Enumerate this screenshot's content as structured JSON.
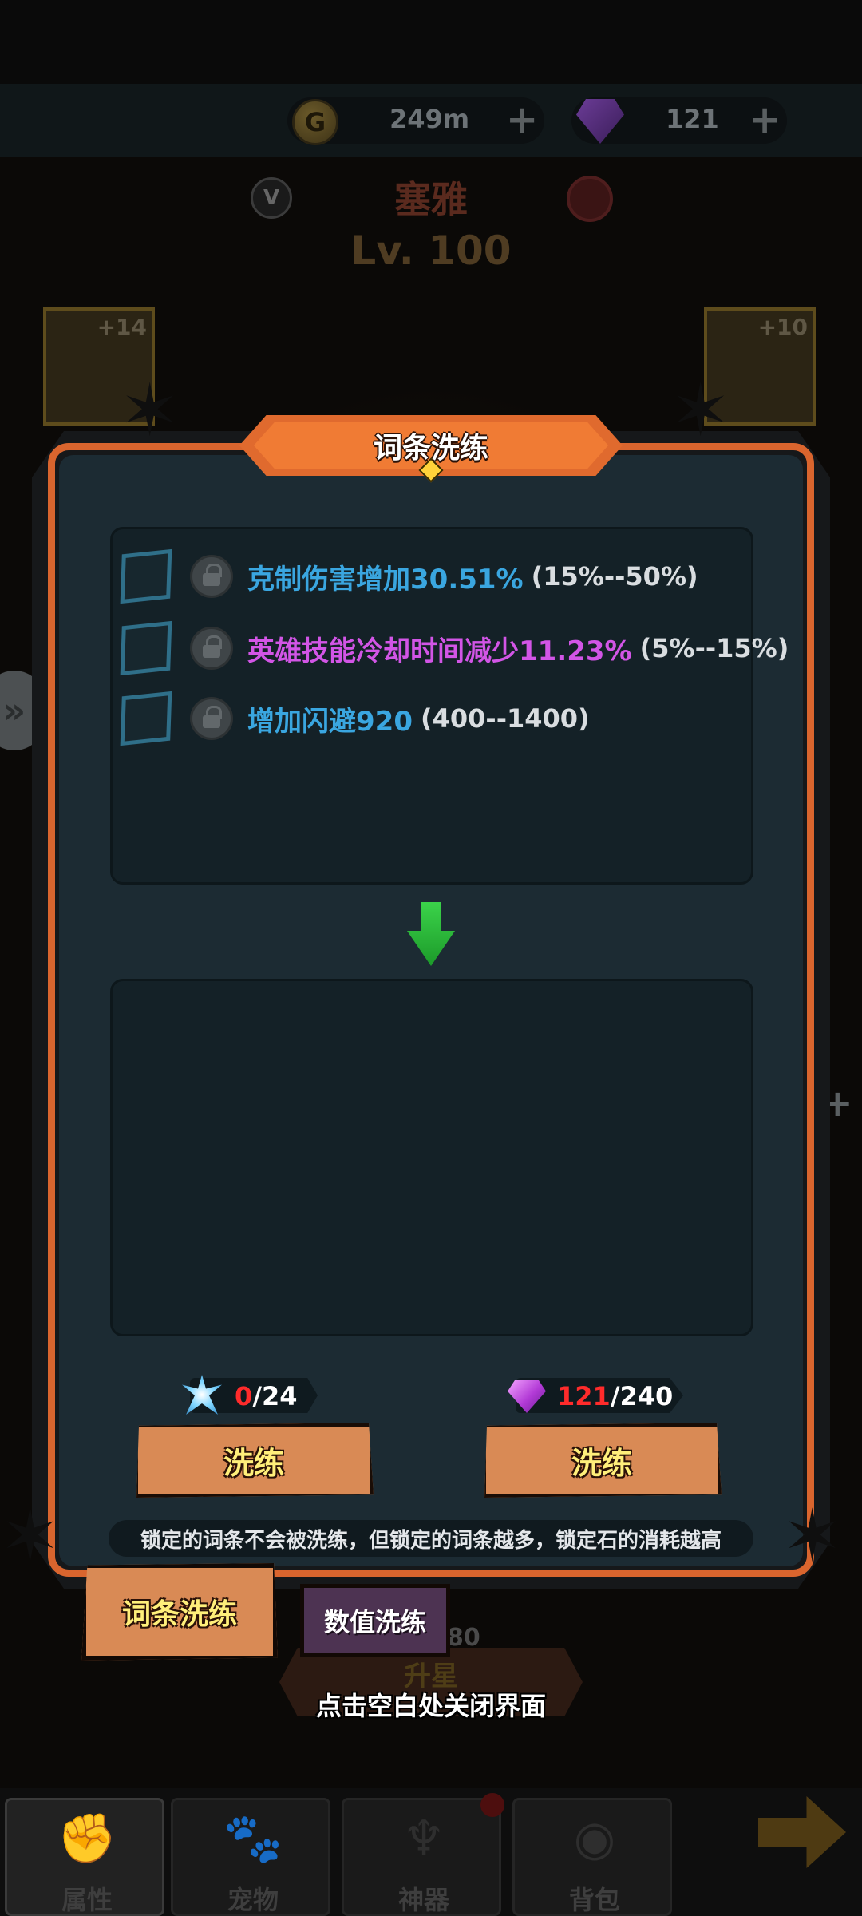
{
  "currency": {
    "gold_value": "249m",
    "gold_icon_letter": "G",
    "gem_value": "121",
    "plus": "+"
  },
  "hero": {
    "name": "塞雅",
    "level": "Lv. 100",
    "vip_badge": "V"
  },
  "equipment": {
    "left_plus": "+14",
    "right_plus": "+10"
  },
  "side_tab_glyph": "»",
  "dialog": {
    "title": "词条洗练",
    "current_stats": [
      {
        "name": "克制伤害增加30.51%",
        "range": "(15%--50%)",
        "color": "#3aa6e0"
      },
      {
        "name": "英雄技能冷却时间减少11.23%",
        "range": "(5%--15%)",
        "color": "#d255e6"
      },
      {
        "name": "增加闪避920",
        "range": "(400--1400)",
        "color": "#3aa6e0"
      }
    ],
    "costs": [
      {
        "icon": "lock-stone-icon",
        "have": "0",
        "need": "/24"
      },
      {
        "icon": "gem-icon",
        "have": "121",
        "need": "/240"
      }
    ],
    "reroll_buttons": [
      "洗练",
      "洗练"
    ],
    "note": "锁定的词条不会被洗练，但锁定的词条越多，锁定石的消耗越高"
  },
  "tabs": {
    "active": "词条洗练",
    "inactive": "数值洗练"
  },
  "background": {
    "partial_number": "80",
    "star_up_label": "升星"
  },
  "close_hint": "点击空白处关闭界面",
  "bottom_nav": [
    {
      "label": "属性",
      "icon": "fist-icon",
      "glyph": "✊"
    },
    {
      "label": "宠物",
      "icon": "paw-icon",
      "glyph": "🐾"
    },
    {
      "label": "神器",
      "icon": "trident-icon",
      "glyph": "♆"
    },
    {
      "label": "背包",
      "icon": "bag-icon",
      "glyph": "◉"
    }
  ],
  "colors": {
    "accent_orange": "#d9652e",
    "panel": "#1c2b33",
    "stat_blue": "#3aa6e0",
    "stat_purple": "#d255e6",
    "cost_red": "#ff2b2b",
    "button_text": "#ffef7a"
  }
}
